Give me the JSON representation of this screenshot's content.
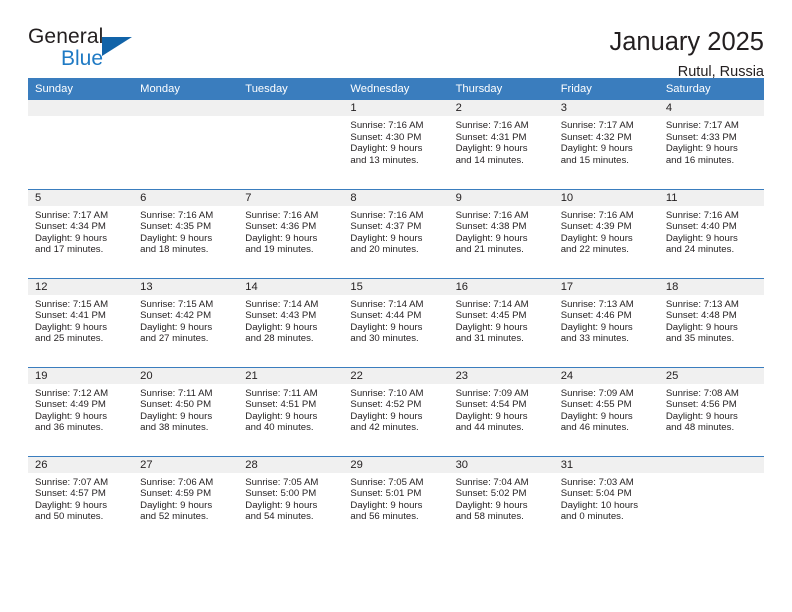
{
  "logo": {
    "word_top": "General",
    "word_bottom": "Blue",
    "triangle_icon": "blue-triangle-icon",
    "accent_color": "#1163a8"
  },
  "header": {
    "title": "January 2025",
    "location": "Rutul, Russia"
  },
  "theme": {
    "header_bar": "#3a7dbe",
    "daynum_bg": "#f0f0f0",
    "text": "#231f20"
  },
  "calendar": {
    "weekday_headers": [
      "Sunday",
      "Monday",
      "Tuesday",
      "Wednesday",
      "Thursday",
      "Friday",
      "Saturday"
    ],
    "labels": {
      "sunrise": "Sunrise:",
      "sunset": "Sunset:",
      "daylight": "Daylight:"
    },
    "weeks": [
      [
        {
          "day": "",
          "sunrise": "",
          "sunset": "",
          "daylight_line1": "",
          "daylight_line2": ""
        },
        {
          "day": "",
          "sunrise": "",
          "sunset": "",
          "daylight_line1": "",
          "daylight_line2": ""
        },
        {
          "day": "",
          "sunrise": "",
          "sunset": "",
          "daylight_line1": "",
          "daylight_line2": ""
        },
        {
          "day": "1",
          "sunrise": "Sunrise: 7:16 AM",
          "sunset": "Sunset: 4:30 PM",
          "daylight_line1": "Daylight: 9 hours",
          "daylight_line2": "and 13 minutes."
        },
        {
          "day": "2",
          "sunrise": "Sunrise: 7:16 AM",
          "sunset": "Sunset: 4:31 PM",
          "daylight_line1": "Daylight: 9 hours",
          "daylight_line2": "and 14 minutes."
        },
        {
          "day": "3",
          "sunrise": "Sunrise: 7:17 AM",
          "sunset": "Sunset: 4:32 PM",
          "daylight_line1": "Daylight: 9 hours",
          "daylight_line2": "and 15 minutes."
        },
        {
          "day": "4",
          "sunrise": "Sunrise: 7:17 AM",
          "sunset": "Sunset: 4:33 PM",
          "daylight_line1": "Daylight: 9 hours",
          "daylight_line2": "and 16 minutes."
        }
      ],
      [
        {
          "day": "5",
          "sunrise": "Sunrise: 7:17 AM",
          "sunset": "Sunset: 4:34 PM",
          "daylight_line1": "Daylight: 9 hours",
          "daylight_line2": "and 17 minutes."
        },
        {
          "day": "6",
          "sunrise": "Sunrise: 7:16 AM",
          "sunset": "Sunset: 4:35 PM",
          "daylight_line1": "Daylight: 9 hours",
          "daylight_line2": "and 18 minutes."
        },
        {
          "day": "7",
          "sunrise": "Sunrise: 7:16 AM",
          "sunset": "Sunset: 4:36 PM",
          "daylight_line1": "Daylight: 9 hours",
          "daylight_line2": "and 19 minutes."
        },
        {
          "day": "8",
          "sunrise": "Sunrise: 7:16 AM",
          "sunset": "Sunset: 4:37 PM",
          "daylight_line1": "Daylight: 9 hours",
          "daylight_line2": "and 20 minutes."
        },
        {
          "day": "9",
          "sunrise": "Sunrise: 7:16 AM",
          "sunset": "Sunset: 4:38 PM",
          "daylight_line1": "Daylight: 9 hours",
          "daylight_line2": "and 21 minutes."
        },
        {
          "day": "10",
          "sunrise": "Sunrise: 7:16 AM",
          "sunset": "Sunset: 4:39 PM",
          "daylight_line1": "Daylight: 9 hours",
          "daylight_line2": "and 22 minutes."
        },
        {
          "day": "11",
          "sunrise": "Sunrise: 7:16 AM",
          "sunset": "Sunset: 4:40 PM",
          "daylight_line1": "Daylight: 9 hours",
          "daylight_line2": "and 24 minutes."
        }
      ],
      [
        {
          "day": "12",
          "sunrise": "Sunrise: 7:15 AM",
          "sunset": "Sunset: 4:41 PM",
          "daylight_line1": "Daylight: 9 hours",
          "daylight_line2": "and 25 minutes."
        },
        {
          "day": "13",
          "sunrise": "Sunrise: 7:15 AM",
          "sunset": "Sunset: 4:42 PM",
          "daylight_line1": "Daylight: 9 hours",
          "daylight_line2": "and 27 minutes."
        },
        {
          "day": "14",
          "sunrise": "Sunrise: 7:14 AM",
          "sunset": "Sunset: 4:43 PM",
          "daylight_line1": "Daylight: 9 hours",
          "daylight_line2": "and 28 minutes."
        },
        {
          "day": "15",
          "sunrise": "Sunrise: 7:14 AM",
          "sunset": "Sunset: 4:44 PM",
          "daylight_line1": "Daylight: 9 hours",
          "daylight_line2": "and 30 minutes."
        },
        {
          "day": "16",
          "sunrise": "Sunrise: 7:14 AM",
          "sunset": "Sunset: 4:45 PM",
          "daylight_line1": "Daylight: 9 hours",
          "daylight_line2": "and 31 minutes."
        },
        {
          "day": "17",
          "sunrise": "Sunrise: 7:13 AM",
          "sunset": "Sunset: 4:46 PM",
          "daylight_line1": "Daylight: 9 hours",
          "daylight_line2": "and 33 minutes."
        },
        {
          "day": "18",
          "sunrise": "Sunrise: 7:13 AM",
          "sunset": "Sunset: 4:48 PM",
          "daylight_line1": "Daylight: 9 hours",
          "daylight_line2": "and 35 minutes."
        }
      ],
      [
        {
          "day": "19",
          "sunrise": "Sunrise: 7:12 AM",
          "sunset": "Sunset: 4:49 PM",
          "daylight_line1": "Daylight: 9 hours",
          "daylight_line2": "and 36 minutes."
        },
        {
          "day": "20",
          "sunrise": "Sunrise: 7:11 AM",
          "sunset": "Sunset: 4:50 PM",
          "daylight_line1": "Daylight: 9 hours",
          "daylight_line2": "and 38 minutes."
        },
        {
          "day": "21",
          "sunrise": "Sunrise: 7:11 AM",
          "sunset": "Sunset: 4:51 PM",
          "daylight_line1": "Daylight: 9 hours",
          "daylight_line2": "and 40 minutes."
        },
        {
          "day": "22",
          "sunrise": "Sunrise: 7:10 AM",
          "sunset": "Sunset: 4:52 PM",
          "daylight_line1": "Daylight: 9 hours",
          "daylight_line2": "and 42 minutes."
        },
        {
          "day": "23",
          "sunrise": "Sunrise: 7:09 AM",
          "sunset": "Sunset: 4:54 PM",
          "daylight_line1": "Daylight: 9 hours",
          "daylight_line2": "and 44 minutes."
        },
        {
          "day": "24",
          "sunrise": "Sunrise: 7:09 AM",
          "sunset": "Sunset: 4:55 PM",
          "daylight_line1": "Daylight: 9 hours",
          "daylight_line2": "and 46 minutes."
        },
        {
          "day": "25",
          "sunrise": "Sunrise: 7:08 AM",
          "sunset": "Sunset: 4:56 PM",
          "daylight_line1": "Daylight: 9 hours",
          "daylight_line2": "and 48 minutes."
        }
      ],
      [
        {
          "day": "26",
          "sunrise": "Sunrise: 7:07 AM",
          "sunset": "Sunset: 4:57 PM",
          "daylight_line1": "Daylight: 9 hours",
          "daylight_line2": "and 50 minutes."
        },
        {
          "day": "27",
          "sunrise": "Sunrise: 7:06 AM",
          "sunset": "Sunset: 4:59 PM",
          "daylight_line1": "Daylight: 9 hours",
          "daylight_line2": "and 52 minutes."
        },
        {
          "day": "28",
          "sunrise": "Sunrise: 7:05 AM",
          "sunset": "Sunset: 5:00 PM",
          "daylight_line1": "Daylight: 9 hours",
          "daylight_line2": "and 54 minutes."
        },
        {
          "day": "29",
          "sunrise": "Sunrise: 7:05 AM",
          "sunset": "Sunset: 5:01 PM",
          "daylight_line1": "Daylight: 9 hours",
          "daylight_line2": "and 56 minutes."
        },
        {
          "day": "30",
          "sunrise": "Sunrise: 7:04 AM",
          "sunset": "Sunset: 5:02 PM",
          "daylight_line1": "Daylight: 9 hours",
          "daylight_line2": "and 58 minutes."
        },
        {
          "day": "31",
          "sunrise": "Sunrise: 7:03 AM",
          "sunset": "Sunset: 5:04 PM",
          "daylight_line1": "Daylight: 10 hours",
          "daylight_line2": "and 0 minutes."
        },
        {
          "day": "",
          "sunrise": "",
          "sunset": "",
          "daylight_line1": "",
          "daylight_line2": ""
        }
      ]
    ]
  }
}
